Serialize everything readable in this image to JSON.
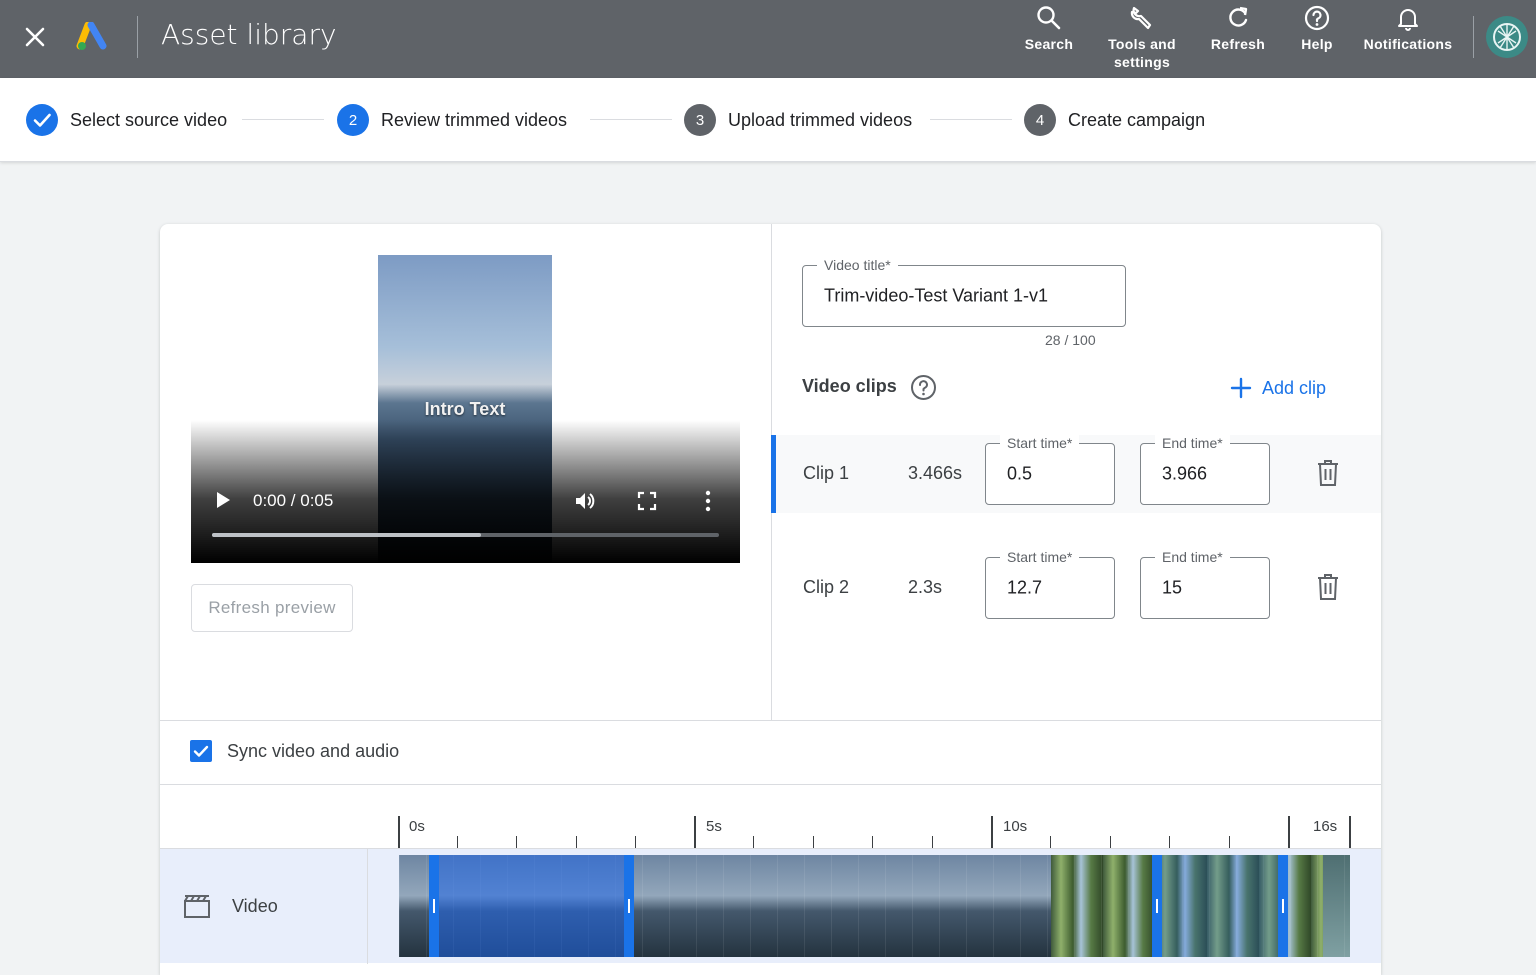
{
  "header": {
    "app_title": "Asset library",
    "tools": [
      {
        "label": "Search",
        "icon": "search-icon"
      },
      {
        "label": "Tools and\nsettings",
        "icon": "wrench-icon"
      },
      {
        "label": "Refresh",
        "icon": "refresh-icon"
      },
      {
        "label": "Help",
        "icon": "help-icon"
      },
      {
        "label": "Notifications",
        "icon": "bell-icon"
      }
    ]
  },
  "stepper": {
    "steps": [
      {
        "number": "",
        "label": "Select source video",
        "state": "complete"
      },
      {
        "number": "2",
        "label": "Review trimmed videos",
        "state": "active"
      },
      {
        "number": "3",
        "label": "Upload trimmed videos",
        "state": "pending"
      },
      {
        "number": "4",
        "label": "Create campaign",
        "state": "pending"
      }
    ]
  },
  "preview": {
    "overlay_text": "Intro Text",
    "time": "0:00 / 0:05",
    "progress": 0.53,
    "refresh_label": "Refresh preview"
  },
  "editor": {
    "title_label": "Video title*",
    "title_value": "Trim-video-Test Variant 1-v1",
    "char_count": "28 / 100",
    "clips_heading": "Video clips",
    "add_clip_label": "Add clip",
    "clips": [
      {
        "name": "Clip 1",
        "duration": "3.466s",
        "start_label": "Start time*",
        "start": "0.5",
        "end_label": "End time*",
        "end": "3.966",
        "active": true
      },
      {
        "name": "Clip 2",
        "duration": "2.3s",
        "start_label": "Start time*",
        "start": "12.7",
        "end_label": "End time*",
        "end": "15",
        "active": false
      }
    ]
  },
  "sync": {
    "label": "Sync video and audio",
    "checked": true
  },
  "timeline": {
    "track_label": "Video",
    "ticks": [
      "0s",
      "5s",
      "10s",
      "16s"
    ],
    "duration_s": 16
  },
  "colors": {
    "accent": "#1a73e8",
    "header_bg": "#5f6368",
    "step_pending": "#5f6368"
  }
}
